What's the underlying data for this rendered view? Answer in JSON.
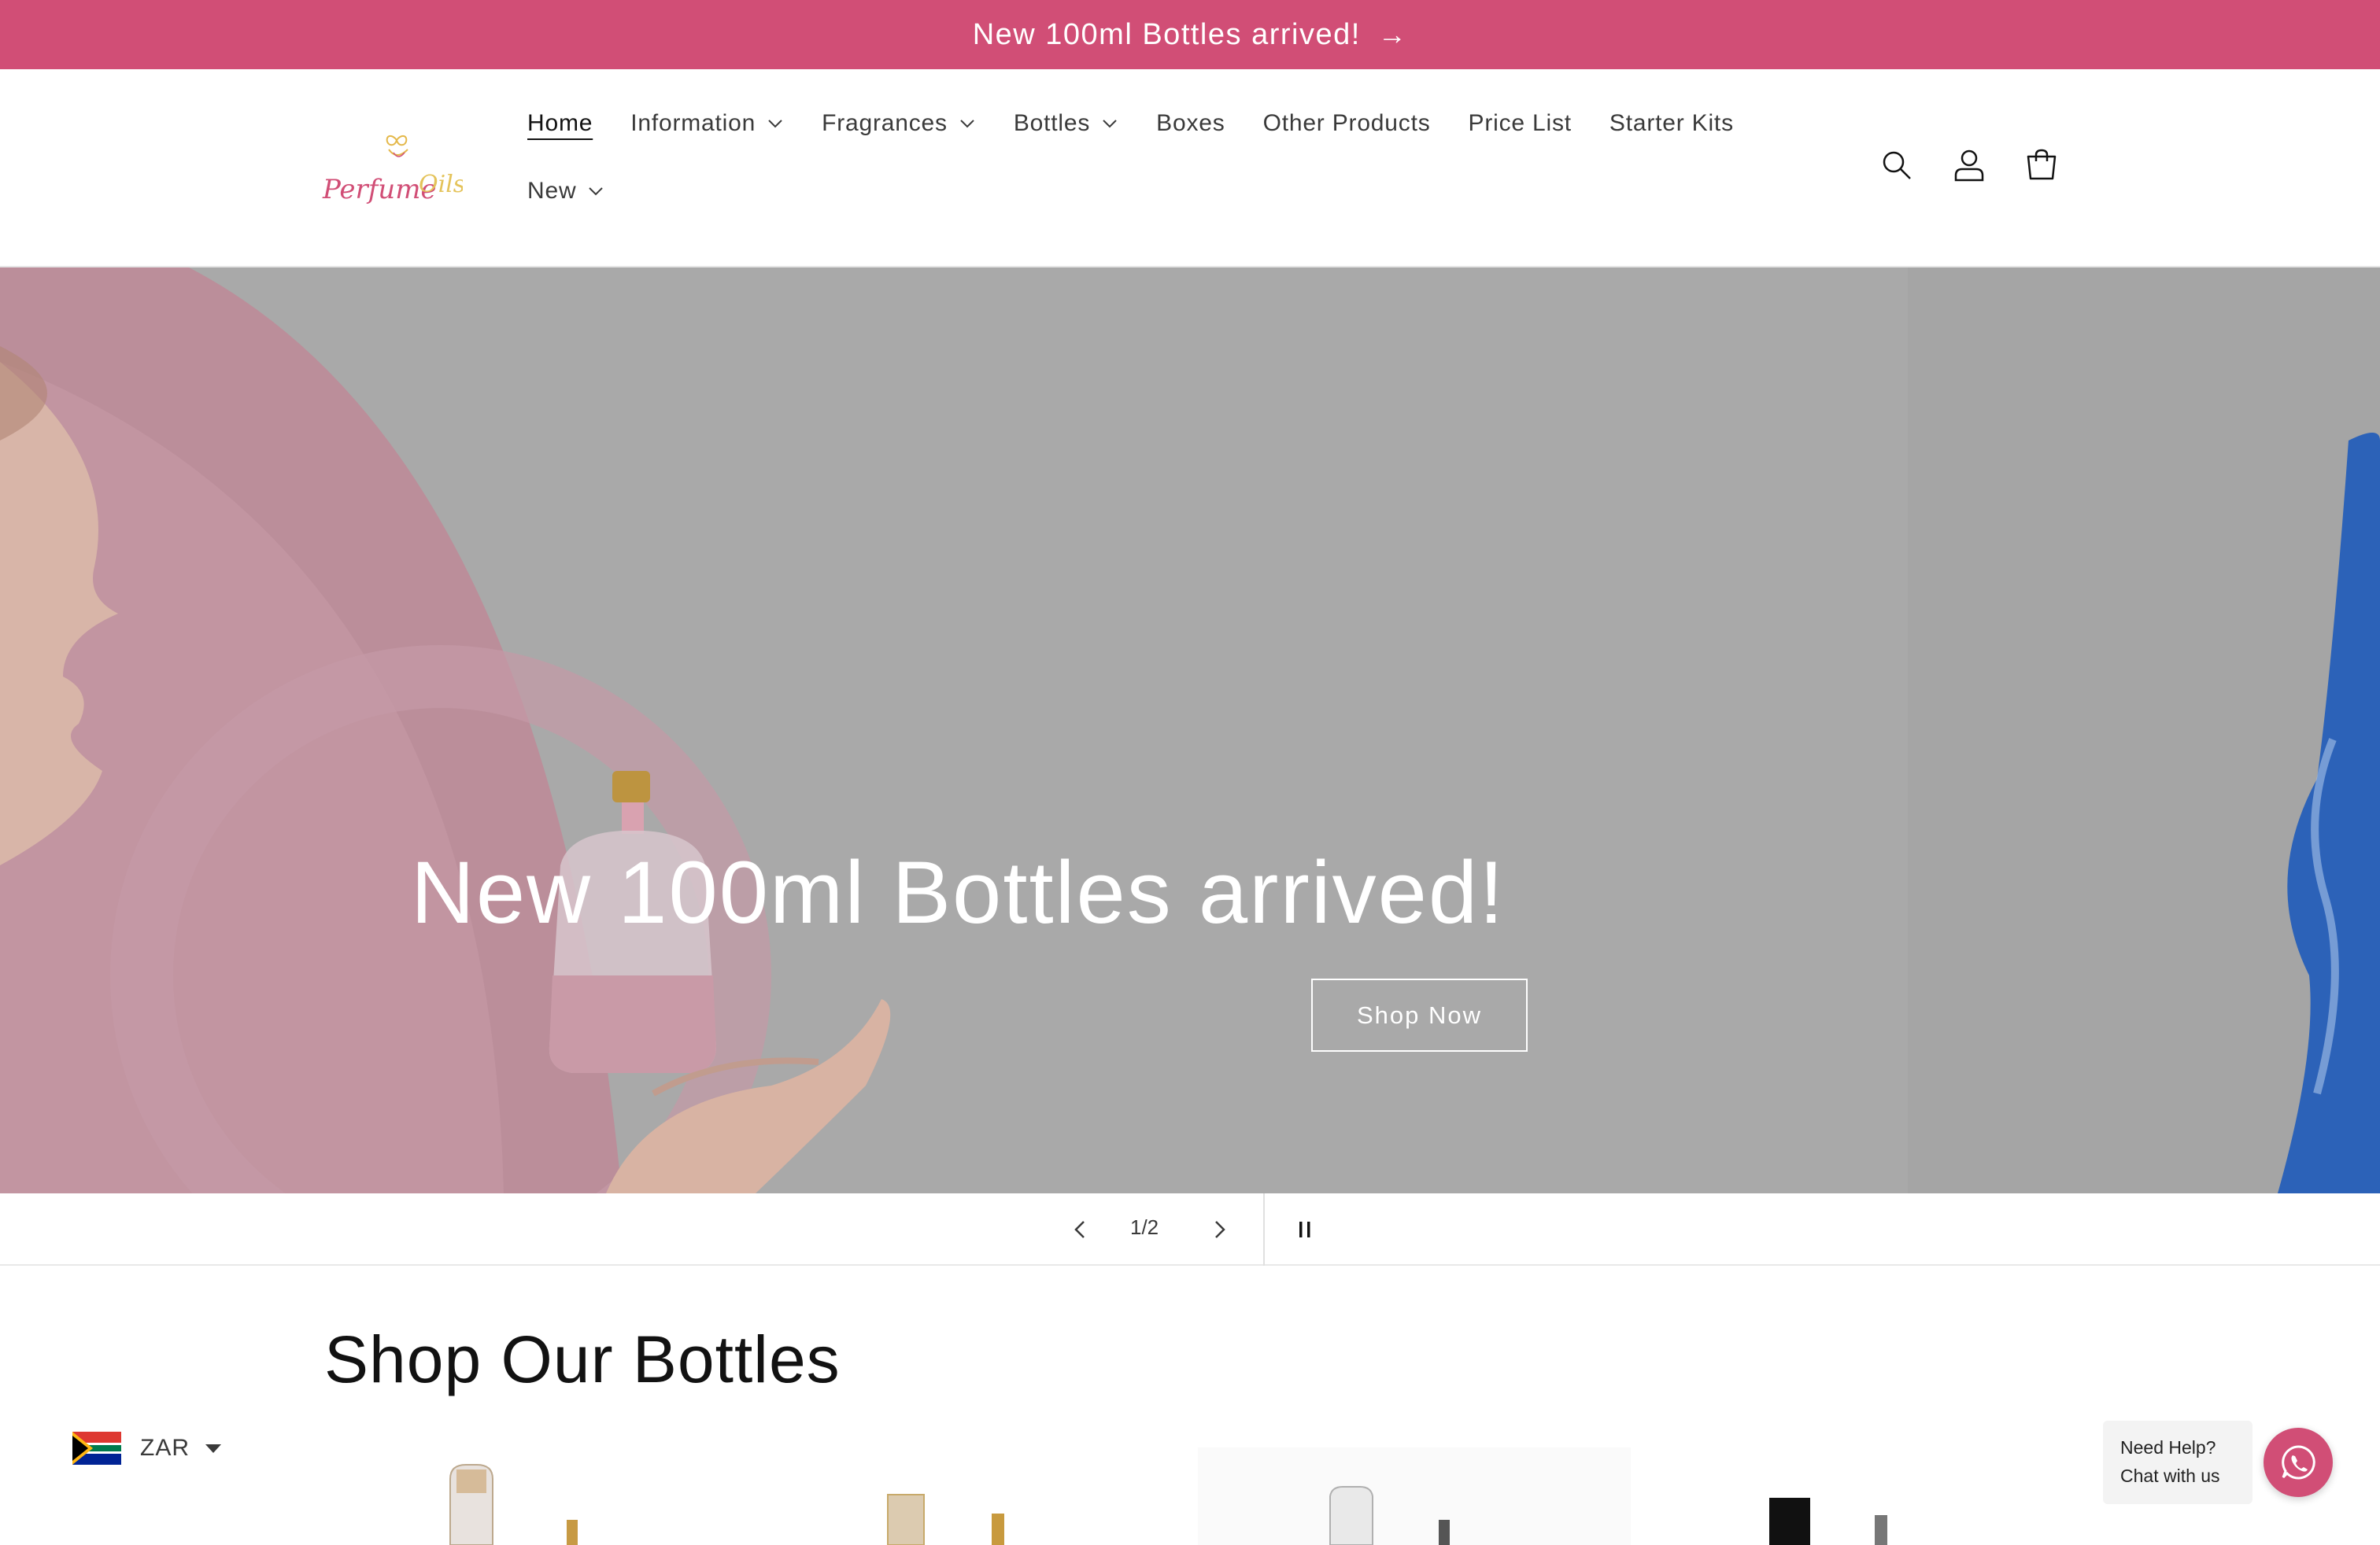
{
  "announcement": {
    "text": "New 100ml Bottles arrived!",
    "arrow_icon": "arrow-right-icon"
  },
  "colors": {
    "brand_pink": "#d14e76",
    "hero_gray": "#a9a9a9",
    "text": "#121212"
  },
  "logo": {
    "name": "perfume-oils-logo",
    "text": "Perfume Oils"
  },
  "nav": {
    "row1": [
      {
        "label": "Home",
        "active": true,
        "dropdown": false
      },
      {
        "label": "Information",
        "dropdown": true
      },
      {
        "label": "Fragrances",
        "dropdown": true
      },
      {
        "label": "Bottles",
        "dropdown": true
      },
      {
        "label": "Boxes",
        "dropdown": false
      },
      {
        "label": "Other Products",
        "dropdown": false
      },
      {
        "label": "Price List",
        "dropdown": false
      },
      {
        "label": "Starter Kits",
        "dropdown": false
      }
    ],
    "row2": [
      {
        "label": "New",
        "dropdown": true
      }
    ]
  },
  "header_icons": [
    "search-icon",
    "account-icon",
    "cart-icon"
  ],
  "hero": {
    "title": "New 100ml Bottles arrived!",
    "button": "Shop Now"
  },
  "slideshow": {
    "counter": "1/2",
    "prev_icon": "chevron-left-icon",
    "next_icon": "chevron-right-icon",
    "pause_icon": "pause-icon"
  },
  "section": {
    "title": "Shop Our Bottles"
  },
  "currency": {
    "code": "ZAR",
    "flag": "south-africa-flag-icon"
  },
  "help": {
    "line1": "Need Help?",
    "line2": "Chat with us",
    "icon": "whatsapp-icon"
  }
}
